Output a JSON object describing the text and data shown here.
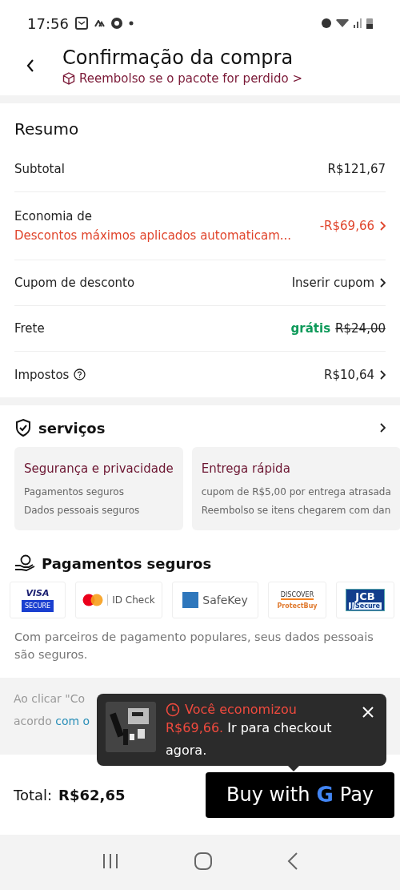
{
  "status_bar": {
    "time": "17:56"
  },
  "header": {
    "title": "Confirmação da compra",
    "subtitle": "Reembolso se o pacote for perdido >"
  },
  "summary": {
    "title": "Resumo",
    "rows": [
      {
        "kind": "plain",
        "label": "Subtotal",
        "value": "R$121,67",
        "chevron": false
      },
      {
        "kind": "discount",
        "label": "Economia de",
        "note": "Descontos máximos aplicados automaticam...",
        "value": "-R$69,66",
        "chevron": true
      },
      {
        "kind": "plain",
        "label": "Cupom de desconto",
        "value": "Inserir cupom",
        "chevron": true
      },
      {
        "kind": "shipping",
        "label": "Frete",
        "badge": "grátis",
        "value": "R$24,00",
        "chevron": false
      },
      {
        "kind": "help",
        "label": "Impostos",
        "value": "R$10,64",
        "chevron": true
      }
    ]
  },
  "services": {
    "title": "serviços",
    "cards": [
      {
        "title": "Segurança e privacidade",
        "lines": [
          "Pagamentos seguros",
          "Dados pessoais seguros"
        ]
      },
      {
        "title": "Entrega rápida",
        "lines": [
          "cupom de R$5,00 por entrega atrasada",
          "Reembolso se itens chegarem com dan"
        ]
      }
    ]
  },
  "payments": {
    "title": "Pagamentos seguros",
    "logos": [
      {
        "kind": "visa",
        "texts": [
          "VISA",
          "SECURE"
        ]
      },
      {
        "kind": "mastercard",
        "texts": [
          "ID Check"
        ]
      },
      {
        "kind": "amex",
        "texts": [
          "SafeKey"
        ]
      },
      {
        "kind": "discover",
        "texts": [
          "DISCOVER",
          "ProtectBuy"
        ]
      },
      {
        "kind": "jcb",
        "texts": [
          "JCB",
          "J/Secure"
        ]
      }
    ],
    "note": "Com parceiros de pagamento populares, seus dados pessoais são seguros."
  },
  "legal": {
    "line_1": "Ao clicar \"Co",
    "line_2": "acordo ",
    "link": "com o"
  },
  "tooltip": {
    "title": "Você economizou",
    "amount": "R$69,66.",
    "message": " Ir para checkout agora."
  },
  "footer": {
    "total_label": "Total:",
    "total": "R$62,65",
    "button": {
      "prefix": "Buy with",
      "logo_letter": "G",
      "suffix": "Pay"
    }
  }
}
